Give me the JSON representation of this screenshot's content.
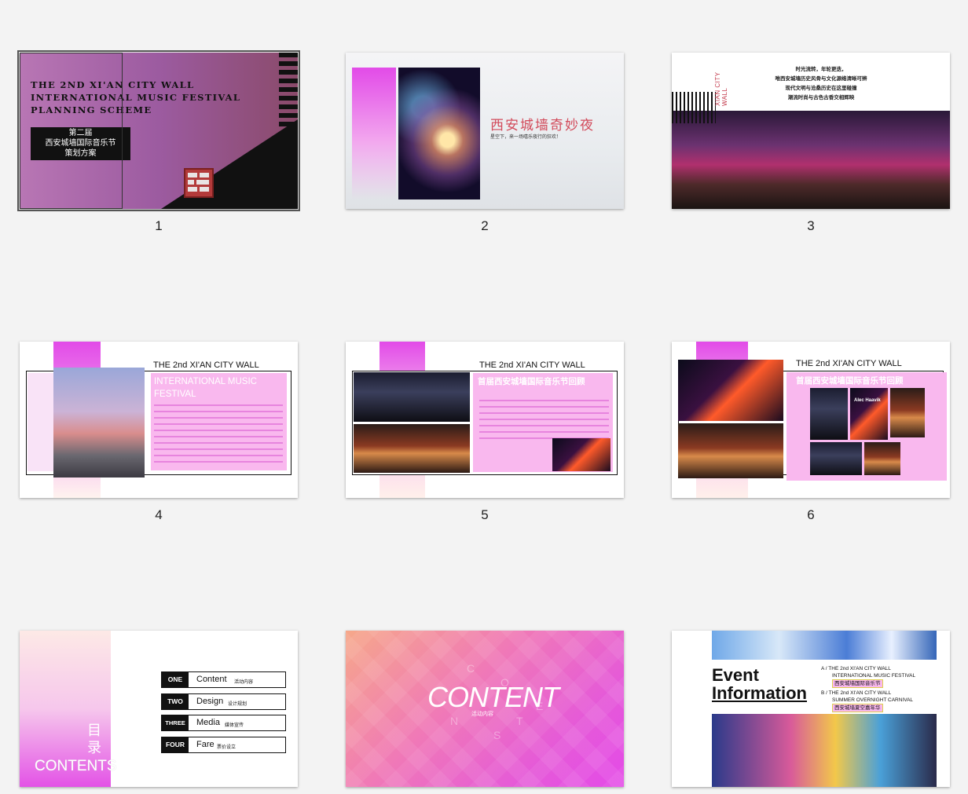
{
  "slides": [
    {
      "number": "1",
      "title_en": [
        "THE 2ND XI'AN CITY WALL",
        "INTERNATIONAL MUSIC FESTIVAL",
        "PLANNING SCHEME"
      ],
      "title_cn": [
        "第二届",
        "西安城墙国际音乐节",
        "策划方案"
      ]
    },
    {
      "number": "2",
      "title": "西安城墙奇妙夜",
      "subtitle": "星空下，来一场嘻乐夜行的狂欢！"
    },
    {
      "number": "3",
      "vertical": "XIAN CITY WALL",
      "lines": [
        "时光流转，年轮更迭，",
        "唯西安城墙历史风骨与文化源络清晰可辨",
        "现代文明与沧桑历史在这里碰撞",
        "潮流时尚与古色古香交相辉映"
      ]
    },
    {
      "number": "4",
      "header": "THE 2nd XI'AN CITY WALL",
      "heading": [
        "INTERNATIONAL MUSIC",
        "FESTIVAL"
      ]
    },
    {
      "number": "5",
      "header": "THE 2nd XI'AN CITY WALL",
      "heading": "首届西安城墙国际音乐节回顾"
    },
    {
      "number": "6",
      "header": "THE 2nd XI'AN CITY WALL",
      "heading": "首届西安城墙国际音乐节回顾",
      "photo_label": "Alec Haavik"
    },
    {
      "number": "7",
      "vertical_cn": [
        "目",
        "录"
      ],
      "contents_label": "CONTENTS",
      "items": [
        {
          "tag": "ONE",
          "en": "Content",
          "cn": "活动内容"
        },
        {
          "tag": "TWO",
          "en": "Design",
          "cn": "设计规划"
        },
        {
          "tag": "THREE",
          "en": "Media",
          "cn": "媒体宣传"
        },
        {
          "tag": "FOUR",
          "en": "Fare",
          "cn": "票价设立"
        }
      ]
    },
    {
      "number": "8",
      "big": "CONTENT",
      "sub": "活动内容",
      "letters": [
        "C",
        "O",
        "N",
        "T",
        "E",
        "N",
        "T",
        "S"
      ]
    },
    {
      "number": "9",
      "title": [
        "Event",
        "Information"
      ],
      "a_label": "A / THE 2nd XI'AN CITY WALL",
      "a_line2": "INTERNATIONAL MUSIC FESTIVAL",
      "a_cn": "西安城墙国际音乐节",
      "b_label": "B / THE 2nd XI'AN CITY WALL",
      "b_line2": "SUMMER OVERNIGHT CARNIVAL",
      "b_cn": "西安城墙夏空嘉年华"
    }
  ],
  "colors": {
    "pink": "#f9b8ee",
    "magenta": "#d63ce9",
    "accent_red": "#c23b3b"
  }
}
